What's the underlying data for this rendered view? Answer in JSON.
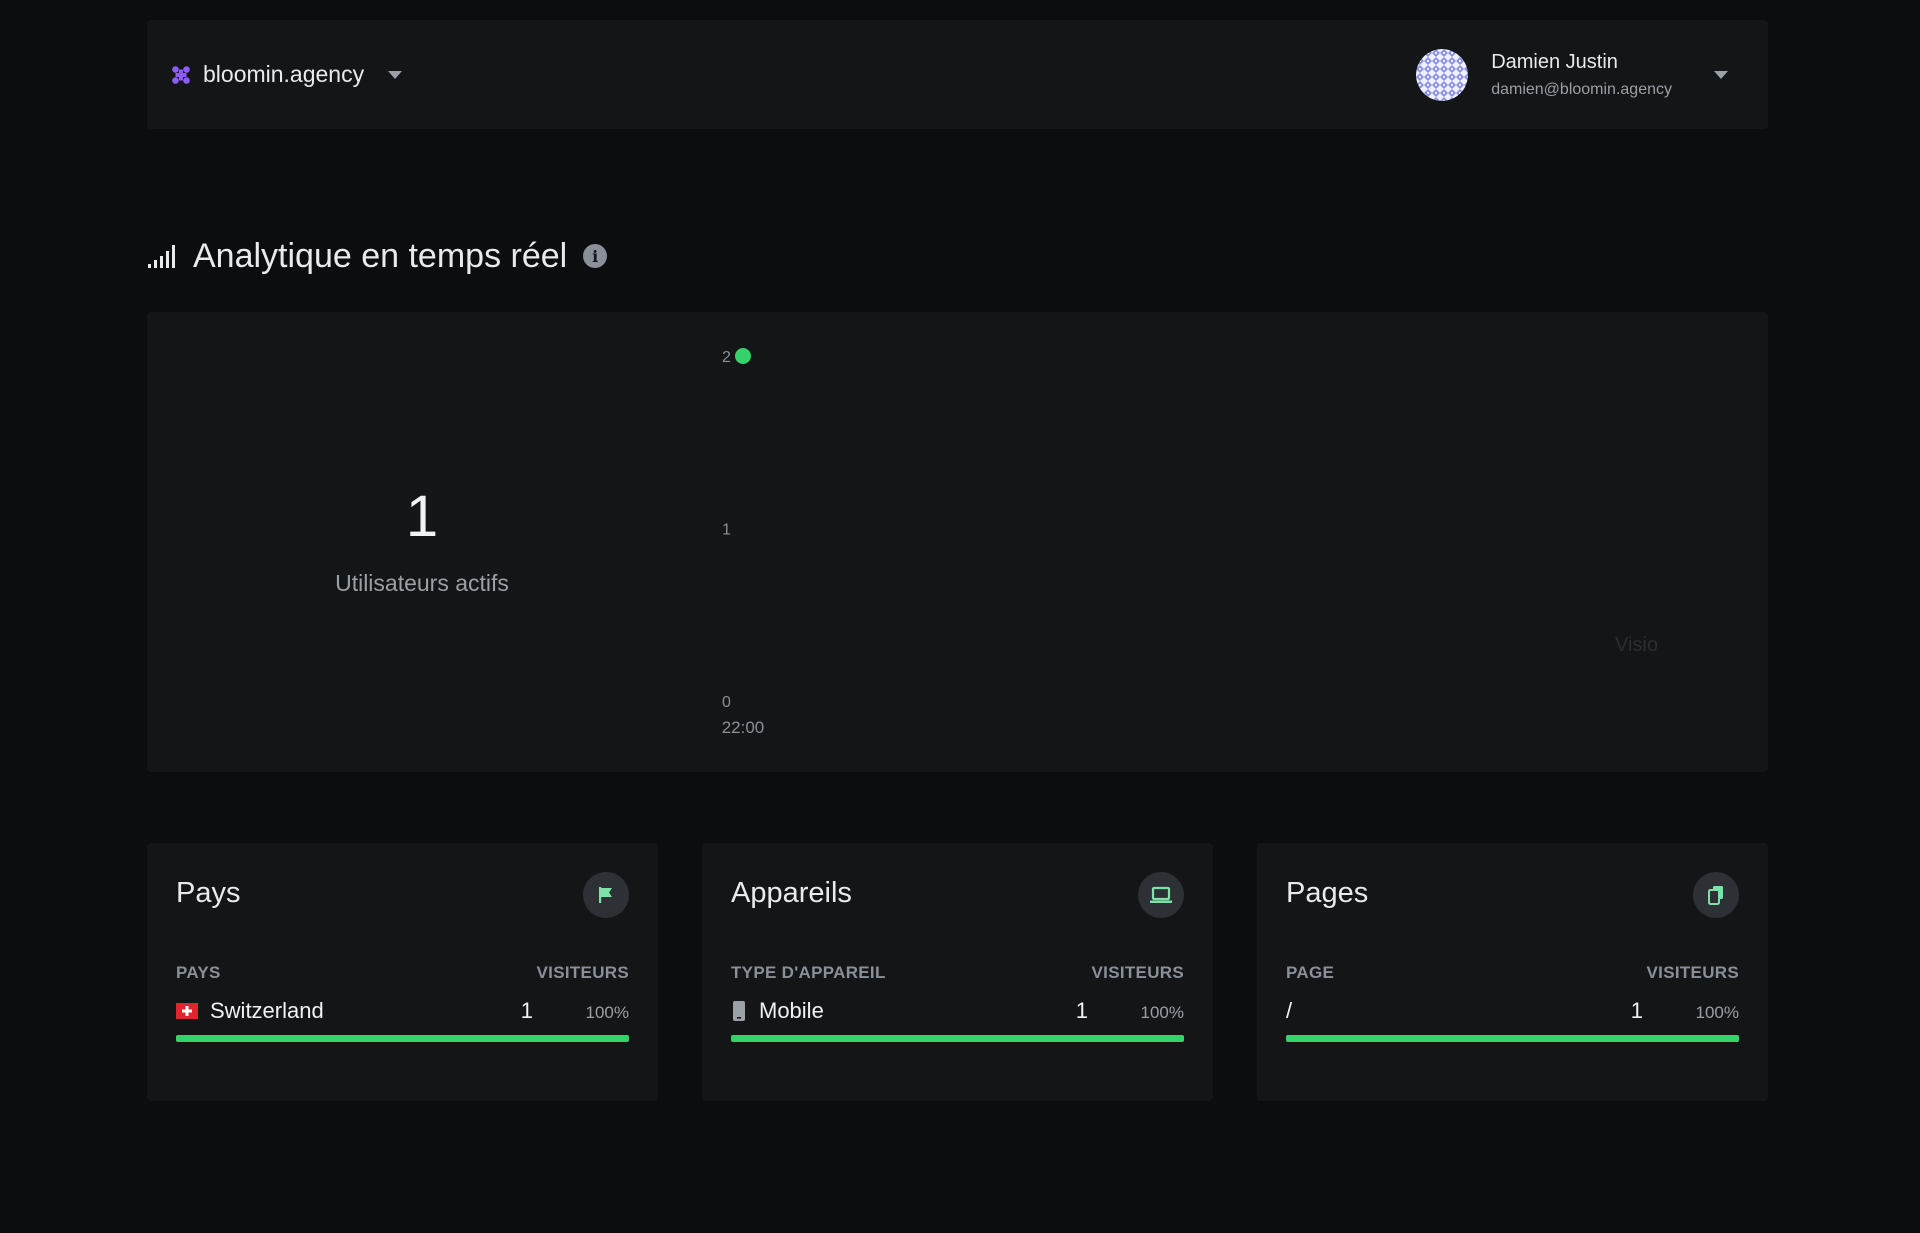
{
  "header": {
    "org_name": "bloomin.agency",
    "user_name": "Damien Justin",
    "user_email": "damien@bloomin.agency",
    "brand_icon": "app-grid-icon"
  },
  "realtime": {
    "title": "Analytique en temps réel",
    "active_users": "1",
    "active_users_label": "Utilisateurs actifs",
    "watermark": "Visio"
  },
  "chart_data": {
    "type": "scatter",
    "x": [
      "22:00"
    ],
    "y": [
      2
    ],
    "yticks": [
      0,
      1,
      2
    ],
    "ylim": [
      0,
      2
    ],
    "color": "#34d26b",
    "grid": false,
    "legend": "none"
  },
  "cards": [
    {
      "title": "Pays",
      "icon": "flag-icon",
      "col_left": "PAYS",
      "col_right": "VISITEURS",
      "rows": [
        {
          "label": "Switzerland",
          "icon": "switzerland-flag-icon",
          "count": "1",
          "pct_label": "100%",
          "fraction": 1.0
        }
      ]
    },
    {
      "title": "Appareils",
      "icon": "laptop-icon",
      "col_left": "TYPE D'APPAREIL",
      "col_right": "VISITEURS",
      "rows": [
        {
          "label": "Mobile",
          "icon": "mobile-icon",
          "count": "1",
          "pct_label": "100%",
          "fraction": 1.0
        }
      ]
    },
    {
      "title": "Pages",
      "icon": "pages-icon",
      "col_left": "PAGE",
      "col_right": "VISITEURS",
      "rows": [
        {
          "label": "/",
          "icon": "",
          "count": "1",
          "pct_label": "100%",
          "fraction": 1.0
        }
      ]
    }
  ],
  "colors": {
    "accent": "#34d26b",
    "brand": "#8b5cf6",
    "panel": "#131517",
    "background": "#0b0d0e"
  }
}
